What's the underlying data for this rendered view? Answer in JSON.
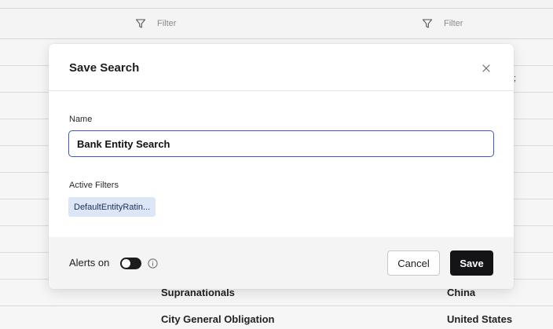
{
  "grid": {
    "filter_placeholder_1": "Filter",
    "filter_placeholder_2": "Filter",
    "rows": [
      {
        "c1": "Supranationals",
        "c2": "China"
      },
      {
        "c1": "City General Obligation",
        "c2": "United States"
      }
    ]
  },
  "modal": {
    "title": "Save Search",
    "close_icon": "close-icon",
    "name_label": "Name",
    "name_value": "Bank Entity Search",
    "filters_label": "Active Filters",
    "filter_chip": "DefaultEntityRatin...",
    "alerts_label": "Alerts on",
    "alerts_enabled": true,
    "cancel_label": "Cancel",
    "save_label": "Save"
  },
  "colors": {
    "accent_border": "#3a5ab8",
    "chip_bg": "#dce6f7",
    "primary_button": "#141416"
  }
}
